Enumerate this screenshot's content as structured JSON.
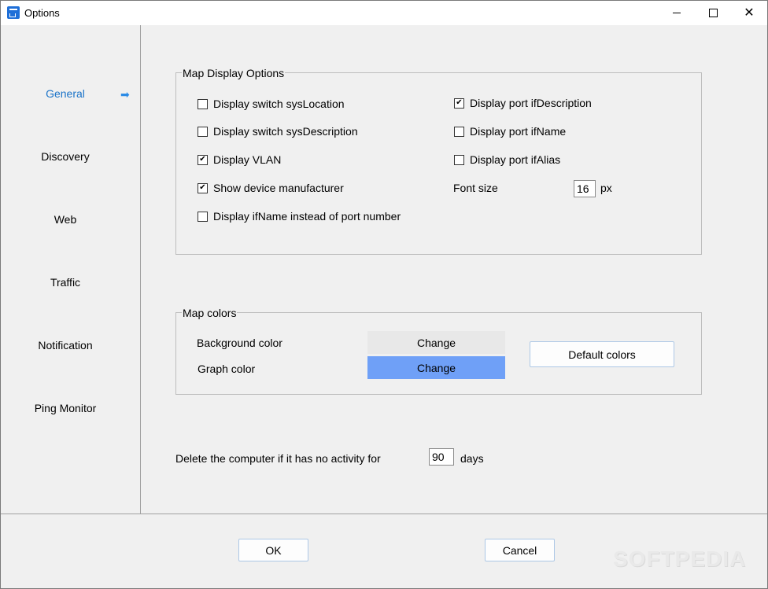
{
  "window": {
    "title": "Options"
  },
  "sidebar": {
    "items": [
      {
        "label": "General",
        "active": true
      },
      {
        "label": "Discovery"
      },
      {
        "label": "Web"
      },
      {
        "label": "Traffic"
      },
      {
        "label": "Notification"
      },
      {
        "label": "Ping Monitor"
      }
    ],
    "active_arrow_icon": "arrow-right-icon"
  },
  "map_display": {
    "legend": "Map Display Options",
    "options_left": [
      {
        "label": "Display switch sysLocation",
        "checked": false
      },
      {
        "label": "Display switch sysDescription",
        "checked": false
      },
      {
        "label": "Display VLAN",
        "checked": true
      },
      {
        "label": "Show device manufacturer",
        "checked": true
      },
      {
        "label": "Display ifName instead of port number",
        "checked": false
      }
    ],
    "options_right": [
      {
        "label": "Display port ifDescription",
        "checked": true
      },
      {
        "label": "Display port ifName",
        "checked": false
      },
      {
        "label": "Display port ifAlias",
        "checked": false
      }
    ],
    "font_size_label": "Font size",
    "font_size_value": "16",
    "font_size_unit": "px"
  },
  "map_colors": {
    "legend": "Map colors",
    "background_label": "Background color",
    "background_button": "Change",
    "background_color": "#e8e8e8",
    "graph_label": "Graph color",
    "graph_button": "Change",
    "graph_color": "#6fa0f7",
    "default_button": "Default colors"
  },
  "retention": {
    "label": "Delete the computer if it has no activity for",
    "value": "90",
    "unit": "days"
  },
  "footer": {
    "ok": "OK",
    "cancel": "Cancel"
  },
  "watermark": "SOFTPEDIA"
}
